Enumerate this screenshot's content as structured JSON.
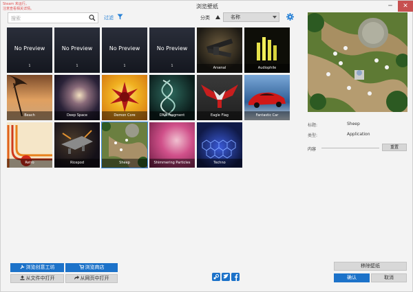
{
  "window": {
    "title": "浏览壁纸",
    "notice_line1": "Steam 未运行。",
    "notice_line2": "注意查看相关详情。",
    "controls": [
      "─",
      "✕"
    ]
  },
  "toolbar": {
    "search_placeholder": "搜索",
    "filter_label": "过滤",
    "sort_label": "分类",
    "sort_value": "名称"
  },
  "tiles": [
    {
      "label": "1",
      "preview_text": "No Preview"
    },
    {
      "label": "1",
      "preview_text": "No Preview"
    },
    {
      "label": "1",
      "preview_text": "No Preview"
    },
    {
      "label": "1",
      "preview_text": "No Preview"
    },
    {
      "label": "Arsenal",
      "preview_text": ""
    },
    {
      "label": "Audiophile",
      "preview_text": ""
    },
    {
      "label": "Beach",
      "preview_text": ""
    },
    {
      "label": "Deep Space",
      "preview_text": ""
    },
    {
      "label": "Demon Core",
      "preview_text": ""
    },
    {
      "label": "DNA Fragment",
      "preview_text": ""
    },
    {
      "label": "Eagle Flag",
      "preview_text": ""
    },
    {
      "label": "Fantastic Car",
      "preview_text": ""
    },
    {
      "label": "Retro",
      "preview_text": ""
    },
    {
      "label": "Ricepod",
      "preview_text": ""
    },
    {
      "label": "Sheep",
      "preview_text": ""
    },
    {
      "label": "Shimmering Particles",
      "preview_text": ""
    },
    {
      "label": "Techno",
      "preview_text": ""
    }
  ],
  "details": {
    "title_label": "标题:",
    "title_value": "Sheep",
    "type_label": "类型:",
    "type_value": "Application",
    "content_label": "内容",
    "reset_button": "重置"
  },
  "bottom": {
    "workshop_button": "浏览创意工坊",
    "store_button": "浏览商店",
    "open_file_button": "从文件中打开",
    "open_web_button": "从网页中打开",
    "remove_button": "移除壁纸",
    "ok_button": "确认",
    "cancel_button": "取消"
  },
  "colors": {
    "accent": "#1c72c9",
    "selection": "#3d8be0",
    "close": "#c75050"
  }
}
